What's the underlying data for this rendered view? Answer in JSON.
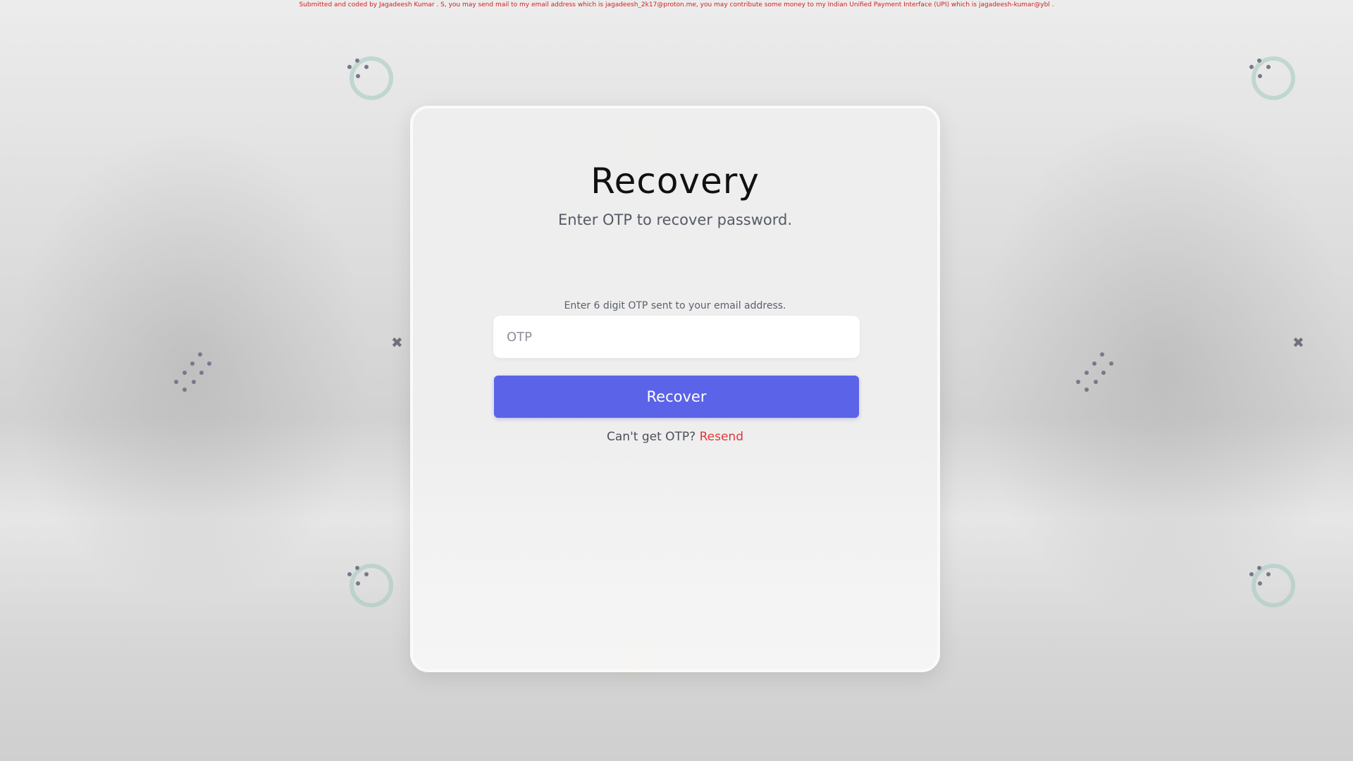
{
  "credit": {
    "text": "Submitted and coded by Jagadeesh Kumar . S, you may send mail to my email address which is jagadeesh_2k17@proton.me, you may contribute some money to my Indian Unified Payment Interface (UPI) which is jagadeesh-kumar@ybl ."
  },
  "recovery": {
    "title": "Recovery",
    "subtitle": "Enter OTP to recover password.",
    "otp_label": "Enter 6 digit OTP sent to your email address.",
    "otp_value": "",
    "otp_placeholder": "OTP",
    "button_label": "Recover",
    "resend_prompt": "Can't get OTP?",
    "resend_link": "Resend"
  },
  "colors": {
    "accent": "#5b63e8",
    "link": "#e0363a",
    "credit": "#d32020"
  },
  "icons": {
    "ring": "ring-icon",
    "dots": "dots-icon",
    "cross": "cross-icon"
  }
}
